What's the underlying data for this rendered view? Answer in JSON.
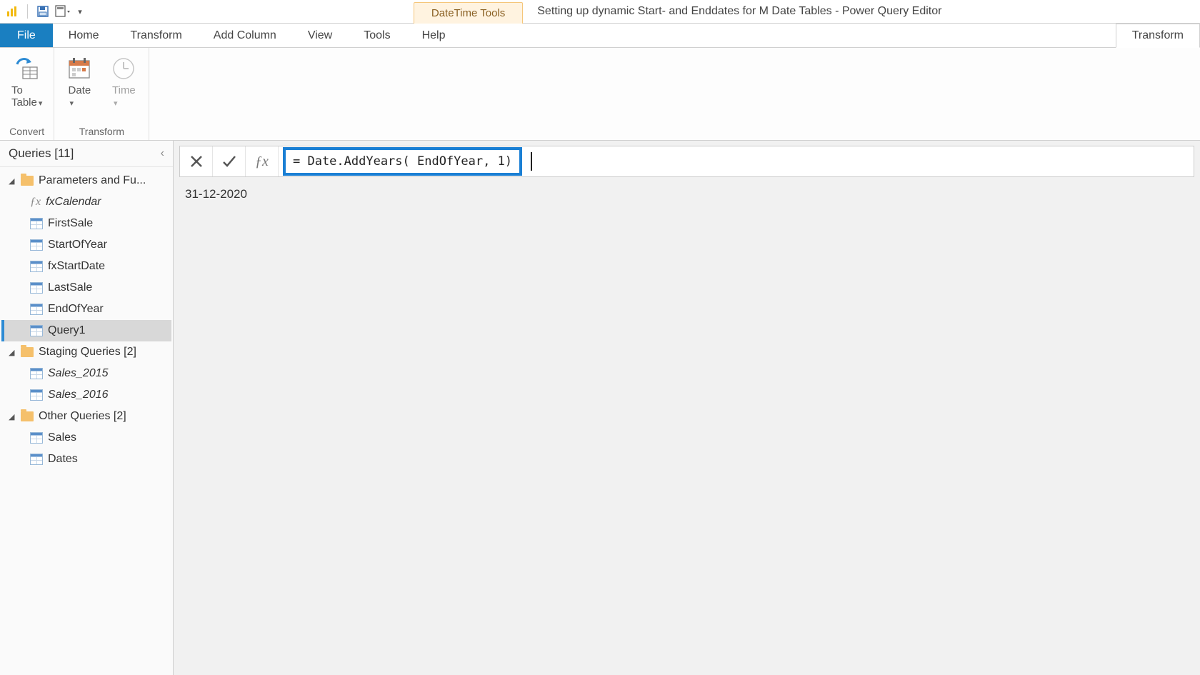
{
  "titleBar": {
    "contextTab": "DateTime Tools",
    "windowTitle": "Setting up dynamic Start- and Enddates for M Date Tables - Power Query Editor"
  },
  "tabs": {
    "file": "File",
    "items": [
      "Home",
      "Transform",
      "Add Column",
      "View",
      "Tools",
      "Help"
    ],
    "contextActive": "Transform"
  },
  "ribbon": {
    "groups": [
      {
        "label": "Convert",
        "buttons": [
          {
            "label": "To\nTable",
            "icon": "to-table-icon",
            "hasDropdown": true
          }
        ]
      },
      {
        "label": "Transform",
        "buttons": [
          {
            "label": "Date",
            "icon": "date-icon",
            "hasDropdown": true
          },
          {
            "label": "Time",
            "icon": "time-icon",
            "hasDropdown": true
          }
        ]
      }
    ]
  },
  "queriesPanel": {
    "title": "Queries [11]",
    "tree": [
      {
        "type": "folder",
        "label": "Parameters and Fu..."
      },
      {
        "type": "leaf",
        "icon": "fx",
        "label": "fxCalendar",
        "italic": true
      },
      {
        "type": "leaf",
        "icon": "table",
        "label": "FirstSale"
      },
      {
        "type": "leaf",
        "icon": "table",
        "label": "StartOfYear"
      },
      {
        "type": "leaf",
        "icon": "table",
        "label": "fxStartDate"
      },
      {
        "type": "leaf",
        "icon": "table",
        "label": "LastSale"
      },
      {
        "type": "leaf",
        "icon": "table",
        "label": "EndOfYear"
      },
      {
        "type": "leaf",
        "icon": "table",
        "label": "Query1",
        "selected": true
      },
      {
        "type": "folder",
        "label": "Staging Queries [2]"
      },
      {
        "type": "leaf",
        "icon": "table",
        "label": "Sales_2015",
        "italic": true
      },
      {
        "type": "leaf",
        "icon": "table",
        "label": "Sales_2016",
        "italic": true
      },
      {
        "type": "folder",
        "label": "Other Queries [2]"
      },
      {
        "type": "leaf",
        "icon": "table",
        "label": "Sales"
      },
      {
        "type": "leaf",
        "icon": "table",
        "label": "Dates"
      }
    ]
  },
  "formulaBar": {
    "formula": "= Date.AddYears( EndOfYear, 1)"
  },
  "result": {
    "value": "31-12-2020"
  }
}
